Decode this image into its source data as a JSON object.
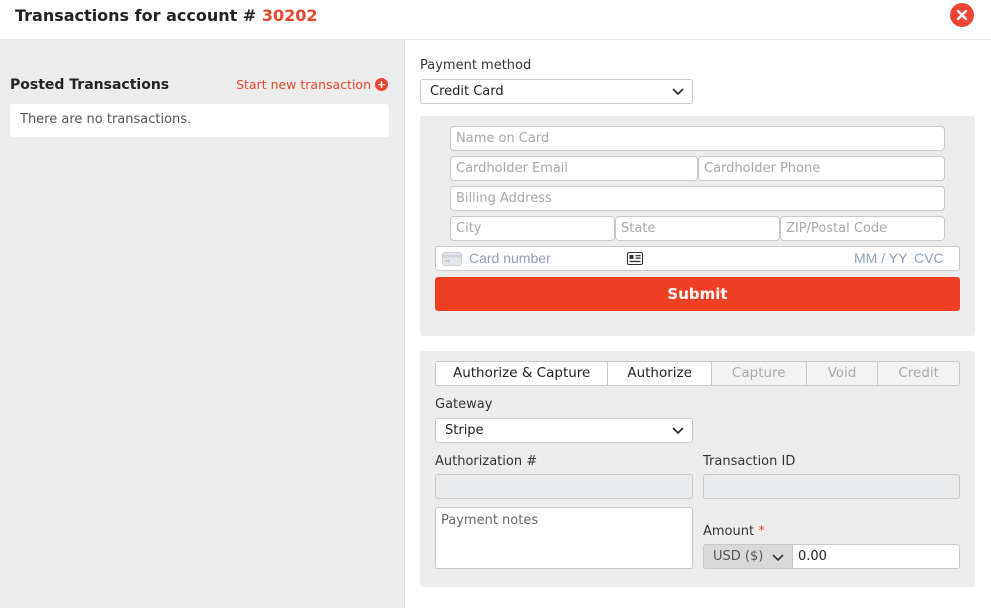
{
  "header": {
    "title_prefix": "Transactions for account #",
    "account_number": "30202"
  },
  "left": {
    "heading": "Posted Transactions",
    "start_link": "Start new transaction",
    "empty_text": "There are no transactions."
  },
  "payment": {
    "method_label": "Payment method",
    "method_value": "Credit Card",
    "fields": {
      "name": "Name on Card",
      "email": "Cardholder Email",
      "phone": "Cardholder Phone",
      "address": "Billing Address",
      "city": "City",
      "state": "State",
      "zip": "ZIP/Postal Code"
    },
    "card": {
      "number_placeholder": "Card number",
      "expiry_placeholder": "MM / YY",
      "cvc_placeholder": "CVC"
    },
    "submit_label": "Submit"
  },
  "transaction": {
    "tabs": [
      {
        "label": "Authorize & Capture",
        "state": "enabled"
      },
      {
        "label": "Authorize",
        "state": "enabled"
      },
      {
        "label": "Capture",
        "state": "disabled"
      },
      {
        "label": "Void",
        "state": "disabled"
      },
      {
        "label": "Credit",
        "state": "disabled"
      }
    ],
    "gateway_label": "Gateway",
    "gateway_value": "Stripe",
    "auth_label": "Authorization #",
    "txn_id_label": "Transaction ID",
    "notes_placeholder": "Payment notes",
    "amount_label": "Amount",
    "amount_required_mark": "*",
    "currency": "USD ($)",
    "amount_value": "0.00"
  },
  "colors": {
    "accent": "#ef4024",
    "panel_bg": "#ececec"
  }
}
